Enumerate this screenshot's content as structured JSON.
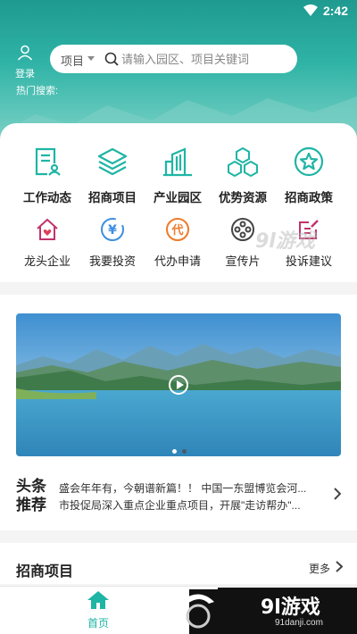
{
  "status_bar": {
    "time": "2:42"
  },
  "header": {
    "login_label": "登录",
    "search_category": "项目",
    "search_placeholder": "请输入园区、项目关键词",
    "hot_search_label": "热门搜索:"
  },
  "menu": {
    "row1": [
      {
        "label": "工作动态",
        "icon": "document-user-icon"
      },
      {
        "label": "招商项目",
        "icon": "layers-icon"
      },
      {
        "label": "产业园区",
        "icon": "buildings-icon"
      },
      {
        "label": "优势资源",
        "icon": "hexagons-icon"
      },
      {
        "label": "招商政策",
        "icon": "star-circle-icon"
      }
    ],
    "row2": [
      {
        "label": "龙头企业",
        "icon": "house-heart-icon"
      },
      {
        "label": "我要投资",
        "icon": "yuan-circle-icon",
        "glyph": "¥"
      },
      {
        "label": "代办申请",
        "icon": "dai-circle-icon",
        "glyph": "代"
      },
      {
        "label": "宣传片",
        "icon": "film-reel-icon"
      },
      {
        "label": "投诉建议",
        "icon": "edit-box-icon"
      }
    ]
  },
  "video": {
    "slide_count": 2,
    "active_slide": 1
  },
  "headlines": {
    "tag_line1": "头条",
    "tag_line2": "推荐",
    "items": [
      "盛会年年有，今朝谱新篇！！ 中国一东盟博览会河...",
      "市投促局深入重点企业重点项目，开展\"走访帮办\"..."
    ]
  },
  "section": {
    "title": "招商项目",
    "more_label": "更多"
  },
  "tabbar": {
    "home_label": "首页"
  },
  "watermark": {
    "brand": "9l游戏",
    "url": "91danji.com",
    "mid_text": "9l游戏"
  },
  "colors": {
    "accent": "#1fb5a4",
    "red_icon": "#e0405a",
    "blue_icon": "#3d8fe0",
    "orange_icon": "#f07a2a",
    "grey_icon": "#555555",
    "purple_icon": "#c2336b"
  }
}
